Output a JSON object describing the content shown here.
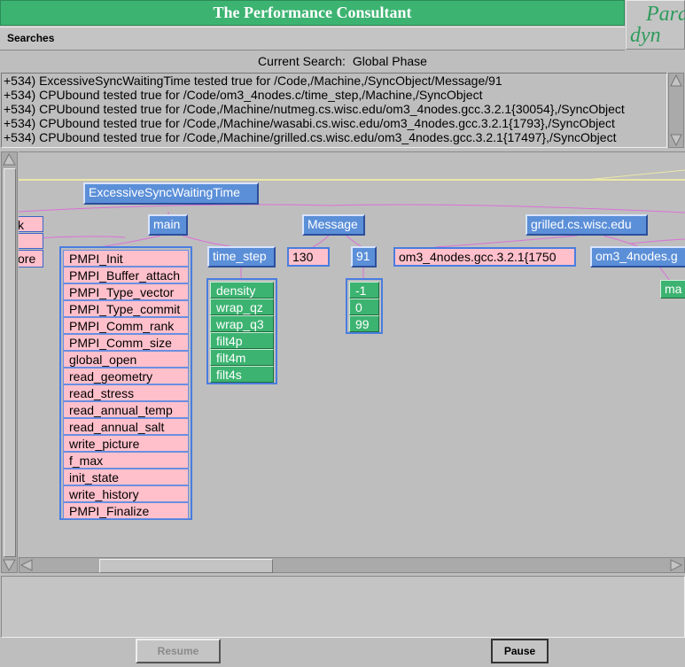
{
  "window": {
    "title": "The Performance Consultant",
    "logo_top": "Para",
    "logo_bottom": "dyn"
  },
  "menu": {
    "searches": "Searches"
  },
  "current_search": {
    "label": "Current Search:",
    "value": "Global Phase"
  },
  "log_lines": [
    "+534) ExcessiveSyncWaitingTime tested true for /Code,/Machine,/SyncObject/Message/91",
    "+534) CPUbound tested true for /Code/om3_4nodes.c/time_step,/Machine,/SyncObject",
    "+534) CPUbound tested true for /Code,/Machine/nutmeg.cs.wisc.edu/om3_4nodes.gcc.3.2.1{30054},/SyncObject",
    "+534) CPUbound tested true for /Code,/Machine/wasabi.cs.wisc.edu/om3_4nodes.gcc.3.2.1{1793},/SyncObject",
    "+534) CPUbound tested true for /Code,/Machine/grilled.cs.wisc.edu/om3_4nodes.gcc.3.2.1{17497},/SyncObject"
  ],
  "tree": {
    "root": "ExcessiveSyncWaitingTime",
    "left_partial": [
      "k",
      "",
      "ore"
    ],
    "main": "main",
    "message": "Message",
    "grilled": "grilled.cs.wisc.edu",
    "main_children": [
      "PMPI_Init",
      "PMPI_Buffer_attach",
      "PMPI_Type_vector",
      "PMPI_Type_commit",
      "PMPI_Comm_rank",
      "PMPI_Comm_size",
      "global_open",
      "read_geometry",
      "read_stress",
      "read_annual_temp",
      "read_annual_salt",
      "write_picture",
      "f_max",
      "init_state",
      "write_history",
      "PMPI_Finalize"
    ],
    "time_step": "time_step",
    "time_step_children": [
      "density",
      "wrap_qz",
      "wrap_q3",
      "filt4p",
      "filt4m",
      "filt4s"
    ],
    "msg_130": "130",
    "msg_91": "91",
    "msg_91_children": [
      "-1",
      "0",
      "99"
    ],
    "proc1": "om3_4nodes.gcc.3.2.1{1750",
    "proc2": "om3_4nodes.g",
    "proc2_child": "ma"
  },
  "buttons": {
    "resume": "Resume",
    "pause": "Pause"
  },
  "colors": {
    "title_bar": "#3cb371",
    "node_blue": "#5b8fd8",
    "node_pink": "#ffc0cb",
    "node_green": "#3cb371",
    "edge": "#da70d6"
  }
}
